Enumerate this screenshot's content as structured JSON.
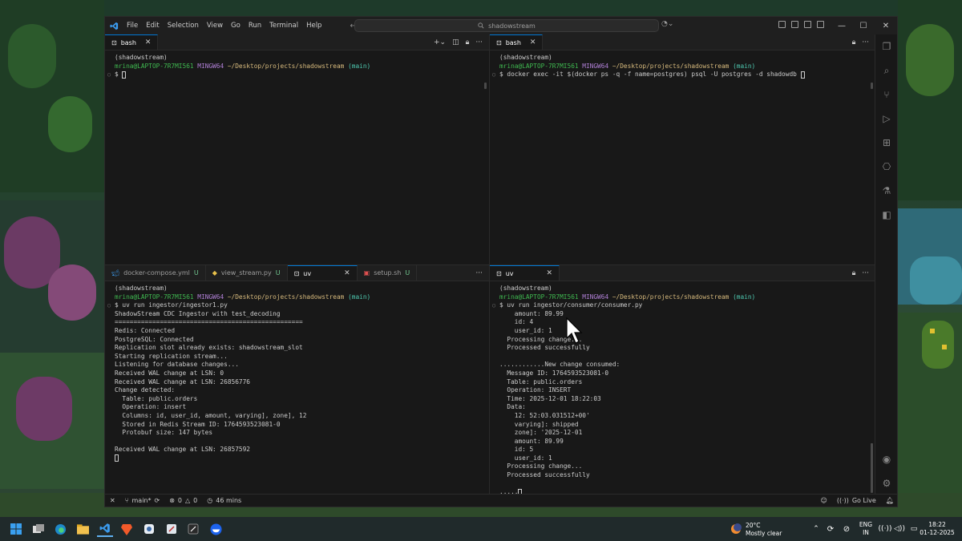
{
  "window": {
    "search_text": "shadowstream",
    "menu": [
      "File",
      "Edit",
      "Selection",
      "View",
      "Go",
      "Run",
      "Terminal",
      "Help"
    ]
  },
  "panes": {
    "top_left": {
      "tabs": [
        {
          "label": "bash"
        }
      ],
      "lines": [
        {
          "parts": [
            {
              "t": "(shadowstream)",
              "c": ""
            }
          ]
        },
        {
          "parts": [
            {
              "t": "mrina@LAPTOP-7R7MI561 ",
              "c": "green"
            },
            {
              "t": "MINGW64 ",
              "c": "purple"
            },
            {
              "t": "~/Desktop/projects/shadowstream ",
              "c": "yellow"
            },
            {
              "t": "(main)",
              "c": "cyan"
            }
          ]
        },
        {
          "parts": [
            {
              "t": "$ ",
              "c": ""
            }
          ],
          "cursor": true,
          "mark": "○"
        }
      ]
    },
    "top_right": {
      "tabs": [
        {
          "label": "bash"
        }
      ],
      "lines": [
        {
          "parts": [
            {
              "t": "(shadowstream)",
              "c": ""
            }
          ]
        },
        {
          "parts": [
            {
              "t": "mrina@LAPTOP-7R7MI561 ",
              "c": "green"
            },
            {
              "t": "MINGW64 ",
              "c": "purple"
            },
            {
              "t": "~/Desktop/projects/shadowstream ",
              "c": "yellow"
            },
            {
              "t": "(main)",
              "c": "cyan"
            }
          ]
        },
        {
          "parts": [
            {
              "t": "$ docker exec -it $(docker ps -q -f name=postgres) psql -U postgres -d shadowdb ",
              "c": ""
            }
          ],
          "cursor": true,
          "mark": "○"
        }
      ]
    },
    "bottom_left": {
      "tabs": [
        {
          "label": "docker-compose.yml",
          "badge": "U",
          "icon": "docker-icon"
        },
        {
          "label": "view_stream.py",
          "badge": "U",
          "icon": "python-icon"
        },
        {
          "label": "uv",
          "badge": "",
          "icon": "terminal-icon",
          "active": true
        },
        {
          "label": "setup.sh",
          "badge": "U",
          "icon": "shell-icon"
        }
      ],
      "lines": [
        {
          "parts": [
            {
              "t": "(shadowstream)",
              "c": ""
            }
          ]
        },
        {
          "parts": [
            {
              "t": "mrina@LAPTOP-7R7MI561 ",
              "c": "green"
            },
            {
              "t": "MINGW64 ",
              "c": "purple"
            },
            {
              "t": "~/Desktop/projects/shadowstream ",
              "c": "yellow"
            },
            {
              "t": "(main)",
              "c": "cyan"
            }
          ]
        },
        {
          "parts": [
            {
              "t": "$ uv run ingestor/ingestor1.py",
              "c": ""
            }
          ],
          "mark": "○"
        },
        {
          "parts": [
            {
              "t": "ShadowStream CDC Ingestor with test_decoding",
              "c": ""
            }
          ]
        },
        {
          "parts": [
            {
              "t": "==================================================",
              "c": ""
            }
          ]
        },
        {
          "parts": [
            {
              "t": "Redis: Connected",
              "c": ""
            }
          ]
        },
        {
          "parts": [
            {
              "t": "PostgreSQL: Connected",
              "c": ""
            }
          ]
        },
        {
          "parts": [
            {
              "t": "Replication slot already exists: shadowstream_slot",
              "c": ""
            }
          ]
        },
        {
          "parts": [
            {
              "t": "Starting replication stream...",
              "c": ""
            }
          ]
        },
        {
          "parts": [
            {
              "t": "Listening for database changes...",
              "c": ""
            }
          ]
        },
        {
          "parts": [
            {
              "t": "Received WAL change at LSN: 0",
              "c": ""
            }
          ]
        },
        {
          "parts": [
            {
              "t": "Received WAL change at LSN: 26856776",
              "c": ""
            }
          ]
        },
        {
          "parts": [
            {
              "t": "Change detected:",
              "c": ""
            }
          ]
        },
        {
          "parts": [
            {
              "t": "  Table: public.orders",
              "c": ""
            }
          ]
        },
        {
          "parts": [
            {
              "t": "  Operation: insert",
              "c": ""
            }
          ]
        },
        {
          "parts": [
            {
              "t": "  Columns: id, user_id, amount, varying], zone], 12",
              "c": ""
            }
          ]
        },
        {
          "parts": [
            {
              "t": "  Stored in Redis Stream ID: 1764593523081-0",
              "c": ""
            }
          ]
        },
        {
          "parts": [
            {
              "t": "  Protobuf size: 147 bytes",
              "c": ""
            }
          ]
        },
        {
          "parts": [
            {
              "t": "",
              "c": ""
            }
          ]
        },
        {
          "parts": [
            {
              "t": "Received WAL change at LSN: 26857592",
              "c": ""
            }
          ]
        },
        {
          "parts": [
            {
              "t": "",
              "c": ""
            }
          ],
          "cursor": true
        }
      ]
    },
    "bottom_right": {
      "tabs": [
        {
          "label": "uv"
        }
      ],
      "lines": [
        {
          "parts": [
            {
              "t": "(shadowstream)",
              "c": ""
            }
          ]
        },
        {
          "parts": [
            {
              "t": "mrina@LAPTOP-7R7MI561 ",
              "c": "green"
            },
            {
              "t": "MINGW64 ",
              "c": "purple"
            },
            {
              "t": "~/Desktop/projects/shadowstream ",
              "c": "yellow"
            },
            {
              "t": "(main)",
              "c": "cyan"
            }
          ]
        },
        {
          "parts": [
            {
              "t": "$ uv run ingestor/consumer/consumer.py",
              "c": ""
            }
          ],
          "mark": "○"
        },
        {
          "parts": [
            {
              "t": "    amount: 89.99",
              "c": ""
            }
          ]
        },
        {
          "parts": [
            {
              "t": "    id: 4",
              "c": ""
            }
          ]
        },
        {
          "parts": [
            {
              "t": "    user_id: 1",
              "c": ""
            }
          ]
        },
        {
          "parts": [
            {
              "t": "  Processing change...",
              "c": ""
            }
          ]
        },
        {
          "parts": [
            {
              "t": "  Processed successfully",
              "c": ""
            }
          ]
        },
        {
          "parts": [
            {
              "t": "",
              "c": ""
            }
          ]
        },
        {
          "parts": [
            {
              "t": "............New change consumed:",
              "c": ""
            }
          ]
        },
        {
          "parts": [
            {
              "t": "  Message ID: 1764593523081-0",
              "c": ""
            }
          ]
        },
        {
          "parts": [
            {
              "t": "  Table: public.orders",
              "c": ""
            }
          ]
        },
        {
          "parts": [
            {
              "t": "  Operation: INSERT",
              "c": ""
            }
          ]
        },
        {
          "parts": [
            {
              "t": "  Time: 2025-12-01 18:22:03",
              "c": ""
            }
          ]
        },
        {
          "parts": [
            {
              "t": "  Data:",
              "c": ""
            }
          ]
        },
        {
          "parts": [
            {
              "t": "    12: 52:03.031512+00'",
              "c": ""
            }
          ]
        },
        {
          "parts": [
            {
              "t": "    varying]: shipped",
              "c": ""
            }
          ]
        },
        {
          "parts": [
            {
              "t": "    zone]: '2025-12-01",
              "c": ""
            }
          ]
        },
        {
          "parts": [
            {
              "t": "    amount: 89.99",
              "c": ""
            }
          ]
        },
        {
          "parts": [
            {
              "t": "    id: 5",
              "c": ""
            }
          ]
        },
        {
          "parts": [
            {
              "t": "    user_id: 1",
              "c": ""
            }
          ]
        },
        {
          "parts": [
            {
              "t": "  Processing change...",
              "c": ""
            }
          ]
        },
        {
          "parts": [
            {
              "t": "  Processed successfully",
              "c": ""
            }
          ]
        },
        {
          "parts": [
            {
              "t": "",
              "c": ""
            }
          ]
        },
        {
          "parts": [
            {
              "t": ".....",
              "c": ""
            }
          ],
          "cursor": true
        }
      ]
    }
  },
  "statusbar": {
    "branch": "main*",
    "errors": "0",
    "warnings": "0",
    "time_tracked": "46 mins",
    "go_live": "Go Live"
  },
  "taskbar": {
    "weather_temp": "20°C",
    "weather_desc": "Mostly clear",
    "lang_line1": "ENG",
    "lang_line2": "IN",
    "clock_time": "18:22",
    "clock_date": "01-12-2025"
  },
  "colors": {
    "accent": "#0078d4",
    "prompt_user": "#3fb950",
    "prompt_mingw": "#b180d7",
    "prompt_path": "#d7ba7d",
    "prompt_branch": "#4ec9b0"
  }
}
